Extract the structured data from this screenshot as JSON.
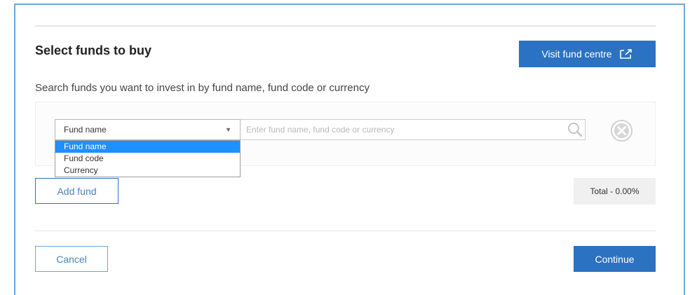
{
  "header": {
    "title": "Select funds to buy",
    "visit_fund_centre_label": "Visit fund centre",
    "visit_icon": "external-link-icon"
  },
  "search": {
    "instructions": "Search funds you want to invest in by fund name, fund code or currency",
    "selected_type": "Fund name",
    "placeholder": "Enter fund name, fund code or currency",
    "value": "",
    "options": [
      "Fund name",
      "Fund code",
      "Currency"
    ],
    "highlighted_option": "Fund name"
  },
  "actions": {
    "add_fund_label": "Add fund",
    "total_label": "Total - 0.00%",
    "cancel_label": "Cancel",
    "continue_label": "Continue"
  },
  "colors": {
    "primary": "#2b72c2",
    "frame_border": "#6fa6d8",
    "dropdown_highlight": "#1e90ff",
    "total_bg": "#f0f0f0"
  }
}
